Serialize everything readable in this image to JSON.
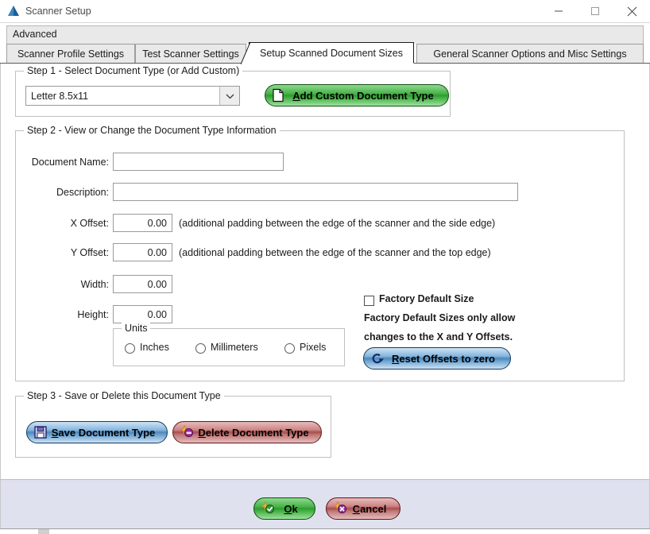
{
  "window": {
    "title": "Scanner Setup",
    "icon": "app-triangle-icon",
    "controls": {
      "minimize": "minimize-icon",
      "maximize": "maximize-icon",
      "close": "close-icon"
    }
  },
  "tabs": {
    "advanced_label": "Advanced",
    "items": [
      {
        "label": "Scanner Profile Settings",
        "active": false
      },
      {
        "label": "Test Scanner Settings",
        "active": false
      },
      {
        "label": "Setup Scanned Document Sizes",
        "active": true
      },
      {
        "label": "General Scanner Options and Misc Settings",
        "active": false
      }
    ]
  },
  "step1": {
    "legend": "Step 1 - Select Document Type (or Add Custom)",
    "document_type_value": "Letter 8.5x11",
    "dropdown_icon": "chevron-down-icon",
    "add_button_label_prefix": "",
    "add_button_label_underlined": "A",
    "add_button_label_rest": "dd Custom Document Type",
    "add_button_icon": "document-icon"
  },
  "step2": {
    "legend": "Step 2 - View or Change the Document Type Information",
    "fields": [
      {
        "label": "Document Name:",
        "value": ""
      },
      {
        "label": "Description:",
        "value": ""
      },
      {
        "label": "X Offset:",
        "value": "0.00",
        "hint": "(additional padding between the edge of the scanner and the side edge)"
      },
      {
        "label": "Y Offset:",
        "value": "0.00",
        "hint": "(additional padding between the edge of the scanner and the top edge)"
      },
      {
        "label": "Width:",
        "value": "0.00"
      },
      {
        "label": "Height:",
        "value": "0.00"
      }
    ],
    "units": {
      "legend": "Units",
      "options": [
        {
          "label": "Inches",
          "selected": false
        },
        {
          "label": "Millimeters",
          "selected": false
        },
        {
          "label": "Pixels",
          "selected": false
        }
      ]
    },
    "factory": {
      "checkbox_label": "Factory Default Size",
      "checked": false,
      "note_line1": "Factory Default Sizes only allow",
      "note_line2": "changes to the X and Y Offsets.",
      "reset_button_underlined": "R",
      "reset_button_rest": "eset Offsets to zero",
      "reset_button_icon": "refresh-arrow-icon"
    }
  },
  "step3": {
    "legend": "Step 3 - Save or Delete this Document Type",
    "save_button_underlined": "S",
    "save_button_rest": "ave Document Type",
    "save_button_icon": "floppy-disk-icon",
    "delete_button_underlined": "D",
    "delete_button_rest": "elete Document Type",
    "delete_button_icon": "delete-star-icon"
  },
  "footer": {
    "ok_underlined": "O",
    "ok_rest": "k",
    "ok_icon": "check-star-icon",
    "cancel_underlined": "C",
    "cancel_rest": "ancel",
    "cancel_icon": "cross-star-icon"
  },
  "colors": {
    "accent_green": "#2f9b31",
    "accent_blue": "#4d87bd",
    "accent_red": "#a84e4e",
    "bottom_bar": "#dfe1ef",
    "tab_inactive": "#e9e9e9"
  }
}
